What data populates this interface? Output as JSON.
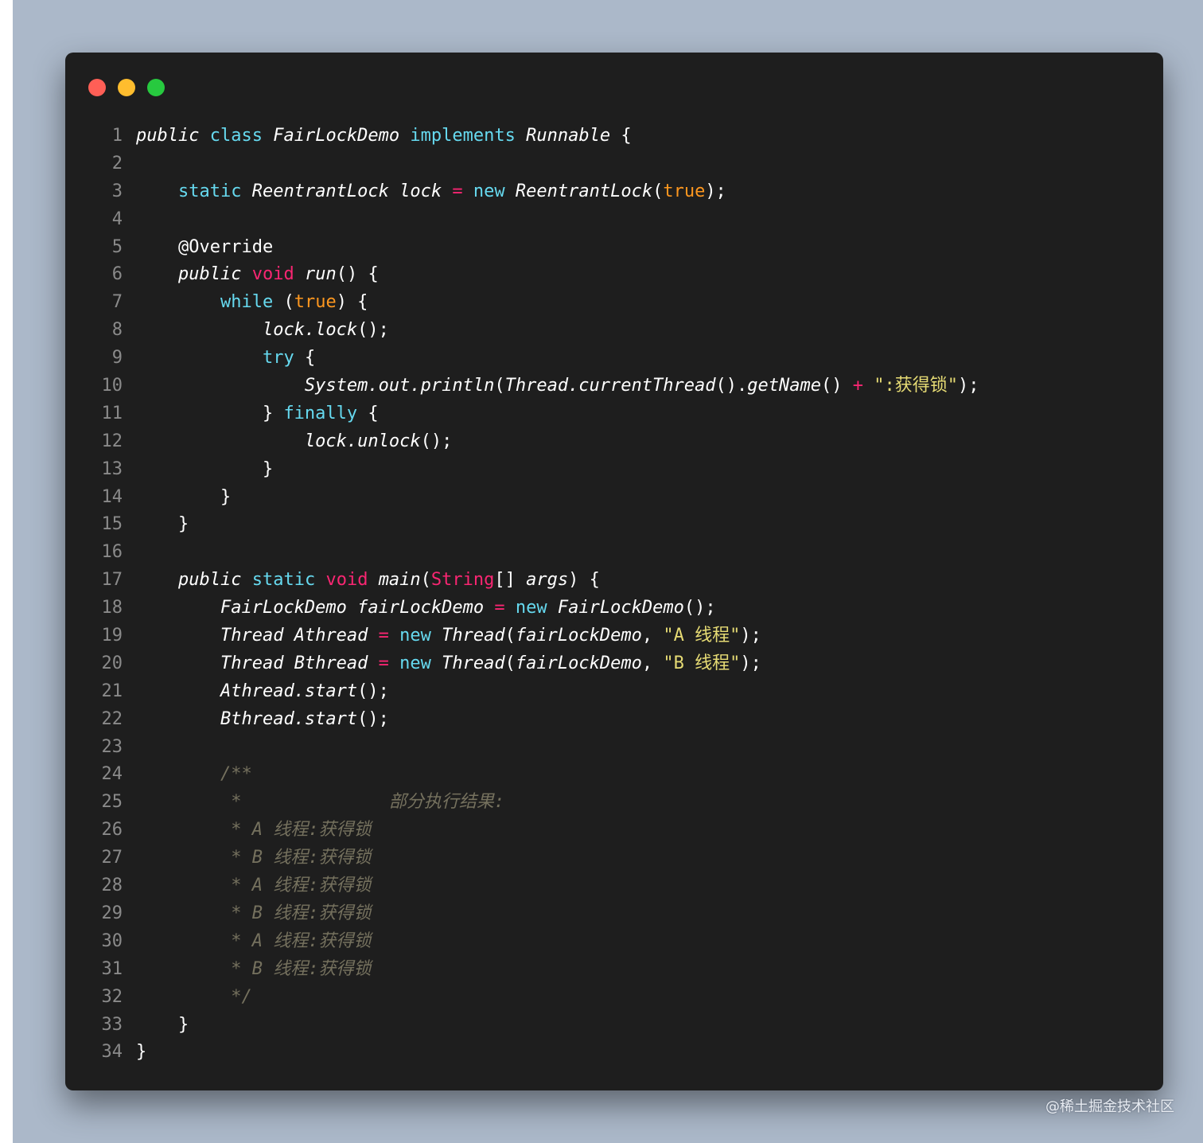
{
  "editor": {
    "window_buttons": [
      {
        "name": "close",
        "color": "#ff5f56"
      },
      {
        "name": "minimize",
        "color": "#ffbd2e"
      },
      {
        "name": "maximize",
        "color": "#27c93f"
      }
    ],
    "colors": {
      "default": "#ffffff",
      "keyword": "#66d9ef",
      "keyword_alt": "#f92672",
      "constant": "#fd971f",
      "string": "#e6db74",
      "operator": "#f92672",
      "comment": "#75715e",
      "line_number": "#8a8a8a",
      "type_red": "#f92672"
    },
    "lines": [
      {
        "n": "1",
        "tokens": [
          [
            "public",
            "ital"
          ],
          [
            " ",
            ""
          ],
          [
            "class",
            "kw"
          ],
          [
            " ",
            ""
          ],
          [
            "FairLockDemo",
            "ital"
          ],
          [
            " ",
            ""
          ],
          [
            "implements",
            "kw"
          ],
          [
            " ",
            ""
          ],
          [
            "Runnable",
            "ital"
          ],
          [
            " {",
            ""
          ]
        ]
      },
      {
        "n": "2",
        "tokens": []
      },
      {
        "n": "3",
        "tokens": [
          [
            "    ",
            ""
          ],
          [
            "static",
            "kw"
          ],
          [
            " ",
            ""
          ],
          [
            "ReentrantLock",
            "ital"
          ],
          [
            " ",
            ""
          ],
          [
            "lock",
            "ital"
          ],
          [
            " ",
            ""
          ],
          [
            "=",
            "op"
          ],
          [
            " ",
            ""
          ],
          [
            "new",
            "kw"
          ],
          [
            " ",
            ""
          ],
          [
            "ReentrantLock",
            "ital"
          ],
          [
            "(",
            ""
          ],
          [
            "true",
            "const"
          ],
          [
            ");",
            ""
          ]
        ]
      },
      {
        "n": "4",
        "tokens": []
      },
      {
        "n": "5",
        "tokens": [
          [
            "    @Override",
            ""
          ]
        ]
      },
      {
        "n": "6",
        "tokens": [
          [
            "    ",
            ""
          ],
          [
            "public",
            "ital"
          ],
          [
            " ",
            ""
          ],
          [
            "void",
            "kw2"
          ],
          [
            " ",
            ""
          ],
          [
            "run",
            "ital"
          ],
          [
            "() {",
            ""
          ]
        ]
      },
      {
        "n": "7",
        "tokens": [
          [
            "        ",
            ""
          ],
          [
            "while",
            "kw"
          ],
          [
            " (",
            ""
          ],
          [
            "true",
            "const"
          ],
          [
            ") {",
            ""
          ]
        ]
      },
      {
        "n": "8",
        "tokens": [
          [
            "            ",
            ""
          ],
          [
            "lock.lock",
            "ital"
          ],
          [
            "();",
            ""
          ]
        ]
      },
      {
        "n": "9",
        "tokens": [
          [
            "            ",
            ""
          ],
          [
            "try",
            "kw"
          ],
          [
            " {",
            ""
          ]
        ]
      },
      {
        "n": "10",
        "tokens": [
          [
            "                ",
            ""
          ],
          [
            "System.out.println",
            "ital"
          ],
          [
            "(",
            ""
          ],
          [
            "Thread.currentThread",
            "ital"
          ],
          [
            "().",
            ""
          ],
          [
            "getName",
            "ital"
          ],
          [
            "() ",
            ""
          ],
          [
            "+",
            "op"
          ],
          [
            " ",
            ""
          ],
          [
            "\":获得锁\"",
            "str"
          ],
          [
            ");",
            ""
          ]
        ]
      },
      {
        "n": "11",
        "tokens": [
          [
            "            } ",
            ""
          ],
          [
            "finally",
            "kw"
          ],
          [
            " {",
            ""
          ]
        ]
      },
      {
        "n": "12",
        "tokens": [
          [
            "                ",
            ""
          ],
          [
            "lock.unlock",
            "ital"
          ],
          [
            "();",
            ""
          ]
        ]
      },
      {
        "n": "13",
        "tokens": [
          [
            "            }",
            ""
          ]
        ]
      },
      {
        "n": "14",
        "tokens": [
          [
            "        }",
            ""
          ]
        ]
      },
      {
        "n": "15",
        "tokens": [
          [
            "    }",
            ""
          ]
        ]
      },
      {
        "n": "16",
        "tokens": []
      },
      {
        "n": "17",
        "tokens": [
          [
            "    ",
            ""
          ],
          [
            "public",
            "ital"
          ],
          [
            " ",
            ""
          ],
          [
            "static",
            "kw"
          ],
          [
            " ",
            ""
          ],
          [
            "void",
            "kw2"
          ],
          [
            " ",
            ""
          ],
          [
            "main",
            "ital"
          ],
          [
            "(",
            ""
          ],
          [
            "String",
            "kw2"
          ],
          [
            "[] ",
            ""
          ],
          [
            "args",
            "ital"
          ],
          [
            ") {",
            ""
          ]
        ]
      },
      {
        "n": "18",
        "tokens": [
          [
            "        ",
            ""
          ],
          [
            "FairLockDemo",
            "ital"
          ],
          [
            " ",
            ""
          ],
          [
            "fairLockDemo",
            "ital"
          ],
          [
            " ",
            ""
          ],
          [
            "=",
            "op"
          ],
          [
            " ",
            ""
          ],
          [
            "new",
            "kw"
          ],
          [
            " ",
            ""
          ],
          [
            "FairLockDemo",
            "ital"
          ],
          [
            "();",
            ""
          ]
        ]
      },
      {
        "n": "19",
        "tokens": [
          [
            "        ",
            ""
          ],
          [
            "Thread",
            "ital"
          ],
          [
            " ",
            ""
          ],
          [
            "Athread",
            "ital"
          ],
          [
            " ",
            ""
          ],
          [
            "=",
            "op"
          ],
          [
            " ",
            ""
          ],
          [
            "new",
            "kw"
          ],
          [
            " ",
            ""
          ],
          [
            "Thread",
            "ital"
          ],
          [
            "(",
            ""
          ],
          [
            "fairLockDemo",
            "ital"
          ],
          [
            ", ",
            ""
          ],
          [
            "\"A 线程\"",
            "str"
          ],
          [
            ");",
            ""
          ]
        ]
      },
      {
        "n": "20",
        "tokens": [
          [
            "        ",
            ""
          ],
          [
            "Thread",
            "ital"
          ],
          [
            " ",
            ""
          ],
          [
            "Bthread",
            "ital"
          ],
          [
            " ",
            ""
          ],
          [
            "=",
            "op"
          ],
          [
            " ",
            ""
          ],
          [
            "new",
            "kw"
          ],
          [
            " ",
            ""
          ],
          [
            "Thread",
            "ital"
          ],
          [
            "(",
            ""
          ],
          [
            "fairLockDemo",
            "ital"
          ],
          [
            ", ",
            ""
          ],
          [
            "\"B 线程\"",
            "str"
          ],
          [
            ");",
            ""
          ]
        ]
      },
      {
        "n": "21",
        "tokens": [
          [
            "        ",
            ""
          ],
          [
            "Athread.start",
            "ital"
          ],
          [
            "();",
            ""
          ]
        ]
      },
      {
        "n": "22",
        "tokens": [
          [
            "        ",
            ""
          ],
          [
            "Bthread.start",
            "ital"
          ],
          [
            "();",
            ""
          ]
        ]
      },
      {
        "n": "23",
        "tokens": []
      },
      {
        "n": "24",
        "tokens": [
          [
            "        ",
            ""
          ],
          [
            "/**",
            "cmt"
          ]
        ]
      },
      {
        "n": "25",
        "tokens": [
          [
            "         ",
            ""
          ],
          [
            "*              部分执行结果:",
            "cmt"
          ]
        ]
      },
      {
        "n": "26",
        "tokens": [
          [
            "         ",
            ""
          ],
          [
            "* A 线程:获得锁",
            "cmt"
          ]
        ]
      },
      {
        "n": "27",
        "tokens": [
          [
            "         ",
            ""
          ],
          [
            "* B 线程:获得锁",
            "cmt"
          ]
        ]
      },
      {
        "n": "28",
        "tokens": [
          [
            "         ",
            ""
          ],
          [
            "* A 线程:获得锁",
            "cmt"
          ]
        ]
      },
      {
        "n": "29",
        "tokens": [
          [
            "         ",
            ""
          ],
          [
            "* B 线程:获得锁",
            "cmt"
          ]
        ]
      },
      {
        "n": "30",
        "tokens": [
          [
            "         ",
            ""
          ],
          [
            "* A 线程:获得锁",
            "cmt"
          ]
        ]
      },
      {
        "n": "31",
        "tokens": [
          [
            "         ",
            ""
          ],
          [
            "* B 线程:获得锁",
            "cmt"
          ]
        ]
      },
      {
        "n": "32",
        "tokens": [
          [
            "         ",
            ""
          ],
          [
            "*/",
            "cmt"
          ]
        ]
      },
      {
        "n": "33",
        "tokens": [
          [
            "    }",
            ""
          ]
        ]
      },
      {
        "n": "34",
        "tokens": [
          [
            "}",
            ""
          ]
        ]
      }
    ]
  },
  "watermark": "@稀土掘金技术社区"
}
